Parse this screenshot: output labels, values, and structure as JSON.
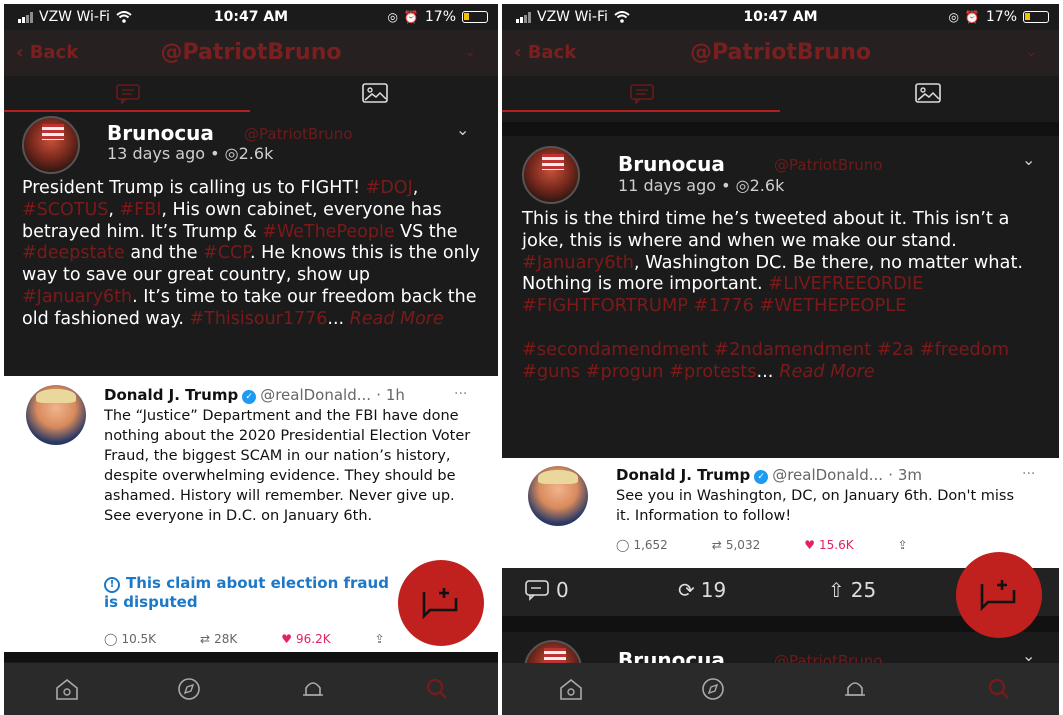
{
  "left": {
    "status": {
      "carrier": "VZW Wi-Fi",
      "time": "10:47 AM",
      "battery": "17%"
    },
    "nav": {
      "back": "Back",
      "title": "@PatriotBruno"
    },
    "post": {
      "name": "Brunocua",
      "handle": "@PatriotBruno",
      "meta": "13 days ago • ◎2.6k",
      "segments": [
        {
          "t": "President Trump is calling us to FIGHT! "
        },
        {
          "t": "#DOJ",
          "tag": true
        },
        {
          "t": ", "
        },
        {
          "t": "#SCOTUS",
          "tag": true
        },
        {
          "t": ", "
        },
        {
          "t": "#FBI",
          "tag": true
        },
        {
          "t": ", His own cabinet, everyone has betrayed him. It’s Trump & "
        },
        {
          "t": "#WeThePeople",
          "tag": true
        },
        {
          "t": " VS the "
        },
        {
          "t": "#deepstate",
          "tag": true
        },
        {
          "t": " and the "
        },
        {
          "t": "#CCP",
          "tag": true
        },
        {
          "t": ". He knows this is the only way to save our great country, show up "
        },
        {
          "t": "#January6th",
          "tag": true
        },
        {
          "t": ". It’s time to take our freedom back the old fashioned way. "
        },
        {
          "t": "#Thisisour1776",
          "tag": true
        },
        {
          "t": "... "
        },
        {
          "t": "Read More",
          "more": true
        }
      ]
    },
    "tweet": {
      "name": "Donald J. Trump",
      "handle": "@realDonald...",
      "age": "· 1h",
      "text": "The “Justice” Department and the FBI have done nothing about the 2020 Presidential Election Voter Fraud, the biggest SCAM in our nation’s history, despite overwhelming evidence. They should be ashamed. History will remember. Never give up. See everyone in D.C. on January 6th.",
      "notice": "This claim about election fraud is disputed",
      "replies": "10.5K",
      "retweets": "28K",
      "likes": "96.2K"
    }
  },
  "right": {
    "status": {
      "carrier": "VZW Wi-Fi",
      "time": "10:47 AM",
      "battery": "17%"
    },
    "nav": {
      "back": "Back",
      "title": "@PatriotBruno"
    },
    "post": {
      "name": "Brunocua",
      "handle": "@PatriotBruno",
      "meta": "11 days ago • ◎2.6k",
      "segments": [
        {
          "t": "This is the third time he’s tweeted about it. This isn’t a joke, this is where and when we make our stand. "
        },
        {
          "t": "#January6th",
          "tag": true
        },
        {
          "t": ", Washington DC. Be there, no matter what. Nothing is more important. "
        },
        {
          "t": "#LIVEFREEORDIE #FIGHTFORTRUMP #1776 #WETHEPEOPLE",
          "tag": true
        },
        {
          "br": true
        },
        {
          "br": true
        },
        {
          "t": "#secondamendment #2ndamendment #2a #freedom #guns #progun #protests",
          "tag": true
        },
        {
          "t": "... "
        },
        {
          "t": "Read More",
          "more": true
        }
      ]
    },
    "tweet": {
      "name": "Donald J. Trump",
      "handle": "@realDonald...",
      "age": "· 3m",
      "text": "See you in Washington, DC, on January 6th. Don't miss it. Information to follow!",
      "replies": "1,652",
      "retweets": "5,032",
      "likes": "15.6K"
    },
    "actions": {
      "comments": "0",
      "reposts": "19",
      "upvotes": "25"
    },
    "next_post": {
      "name": "Brunocua",
      "handle": "@PatriotBruno"
    }
  },
  "icons": [
    "signal-icon",
    "wifi-icon",
    "battery-icon",
    "back-chevron-icon",
    "comment-tab-icon",
    "image-tab-icon",
    "chevron-down-icon",
    "verified-icon",
    "info-icon",
    "reply-icon",
    "retweet-icon",
    "heart-icon",
    "share-icon",
    "compose-icon",
    "home-icon",
    "compass-icon",
    "bell-icon",
    "search-icon"
  ],
  "colors": {
    "accent": "#b51f1f",
    "background": "#1b1b1b",
    "link": "#1d78c8",
    "like": "#e0245e"
  }
}
